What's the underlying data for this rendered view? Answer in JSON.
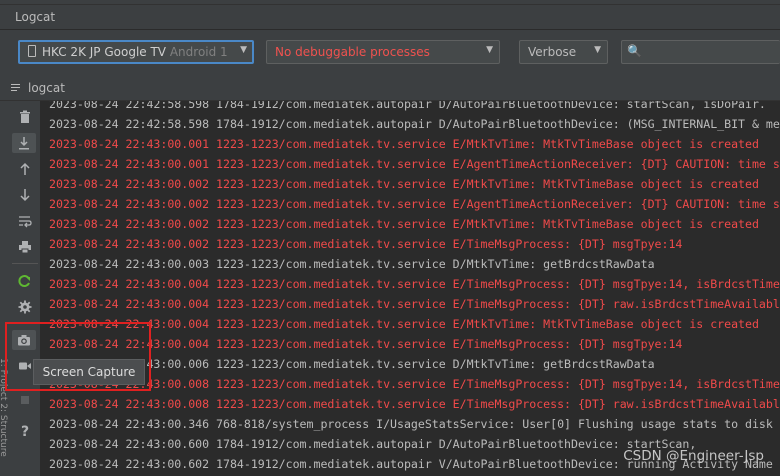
{
  "window": {
    "title": "Logcat"
  },
  "toolbar": {
    "device_name": "HKC 2K JP Google TV",
    "device_os": "Android 1",
    "process": "No debuggable processes",
    "level": "Verbose",
    "search_placeholder": ""
  },
  "tab": {
    "label": "logcat"
  },
  "tooltip": {
    "text": "Screen Capture"
  },
  "watermark": "CSDN @Engineer-Jsp",
  "sidebar_strip_text": "1: Project  2: Structure",
  "sidebar": {
    "buttons": [
      {
        "name": "trash-icon",
        "glyph": "🗑"
      },
      {
        "name": "scroll-to-end-icon",
        "glyph": "⇊"
      },
      {
        "name": "arrow-up-icon",
        "glyph": "↑"
      },
      {
        "name": "arrow-down-icon",
        "glyph": "↓"
      },
      {
        "name": "soft-wrap-icon",
        "glyph": "⤶"
      },
      {
        "name": "print-icon",
        "glyph": "⎙"
      },
      {
        "name": "restart-icon",
        "glyph": "↻"
      },
      {
        "name": "settings-gear-icon",
        "glyph": "⚙"
      },
      {
        "name": "camera-icon",
        "glyph": "📷"
      },
      {
        "name": "video-record-icon",
        "glyph": "▶"
      },
      {
        "name": "help-icon",
        "glyph": "?"
      }
    ]
  },
  "colors": {
    "error": "#f04a4a",
    "info": "#bbbbbb",
    "selection_border": "#e02020",
    "focus": "#4a88c7"
  },
  "log_lines": [
    {
      "text": "2023-08-24 22:42:58.598 1784-1912/com.mediatek.autopair D/AutoPairBluetoothDevice: startScan, isDoPair.",
      "level": "info"
    },
    {
      "text": "2023-08-24 22:42:58.598 1784-1912/com.mediatek.autopair D/AutoPairBluetoothDevice: (MSG_INTERNAL_BIT & me",
      "level": "info"
    },
    {
      "text": "2023-08-24 22:43:00.001 1223-1223/com.mediatek.tv.service E/MtkTvTime: MtkTvTimeBase object is created",
      "level": "error"
    },
    {
      "text": "2023-08-24 22:43:00.001 1223-1223/com.mediatek.tv.service E/AgentTimeActionReceiver: {DT} CAUTION: time s",
      "level": "error"
    },
    {
      "text": "2023-08-24 22:43:00.002 1223-1223/com.mediatek.tv.service E/MtkTvTime: MtkTvTimeBase object is created",
      "level": "error"
    },
    {
      "text": "2023-08-24 22:43:00.002 1223-1223/com.mediatek.tv.service E/AgentTimeActionReceiver: {DT} CAUTION: time s",
      "level": "error"
    },
    {
      "text": "2023-08-24 22:43:00.002 1223-1223/com.mediatek.tv.service E/MtkTvTime: MtkTvTimeBase object is created",
      "level": "error"
    },
    {
      "text": "2023-08-24 22:43:00.002 1223-1223/com.mediatek.tv.service E/TimeMsgProcess: {DT} msgTpye:14",
      "level": "error"
    },
    {
      "text": "2023-08-24 22:43:00.003 1223-1223/com.mediatek.tv.service D/MtkTvTime: getBrdcstRawData",
      "level": "info"
    },
    {
      "text": "2023-08-24 22:43:00.004 1223-1223/com.mediatek.tv.service E/TimeMsgProcess: {DT} msgTpye:14, isBrdcstTime",
      "level": "error"
    },
    {
      "text": "2023-08-24 22:43:00.004 1223-1223/com.mediatek.tv.service E/TimeMsgProcess: {DT} raw.isBrdcstTimeAvailabl",
      "level": "error"
    },
    {
      "text": "2023-08-24 22:43:00.004 1223-1223/com.mediatek.tv.service E/MtkTvTime: MtkTvTimeBase object is created",
      "level": "error"
    },
    {
      "text": "2023-08-24 22:43:00.004 1223-1223/com.mediatek.tv.service E/TimeMsgProcess: {DT} msgTpye:14",
      "level": "error"
    },
    {
      "text": "2023-08-24 22:43:00.006 1223-1223/com.mediatek.tv.service D/MtkTvTime: getBrdcstRawData",
      "level": "info"
    },
    {
      "text": "2023-08-24 22:43:00.008 1223-1223/com.mediatek.tv.service E/TimeMsgProcess: {DT} msgTpye:14, isBrdcstTime",
      "level": "error"
    },
    {
      "text": "2023-08-24 22:43:00.008 1223-1223/com.mediatek.tv.service E/TimeMsgProcess: {DT} raw.isBrdcstTimeAvailabl",
      "level": "error"
    },
    {
      "text": "2023-08-24 22:43:00.346 768-818/system_process I/UsageStatsService: User[0] Flushing usage stats to disk",
      "level": "info"
    },
    {
      "text": "2023-08-24 22:43:00.600 1784-1912/com.mediatek.autopair D/AutoPairBluetoothDevice: startScan,",
      "level": "info"
    },
    {
      "text": "2023-08-24 22:43:00.602 1784-1912/com.mediatek.autopair V/AutoPairBluetoothDevice: running Activity Name",
      "level": "info"
    }
  ]
}
